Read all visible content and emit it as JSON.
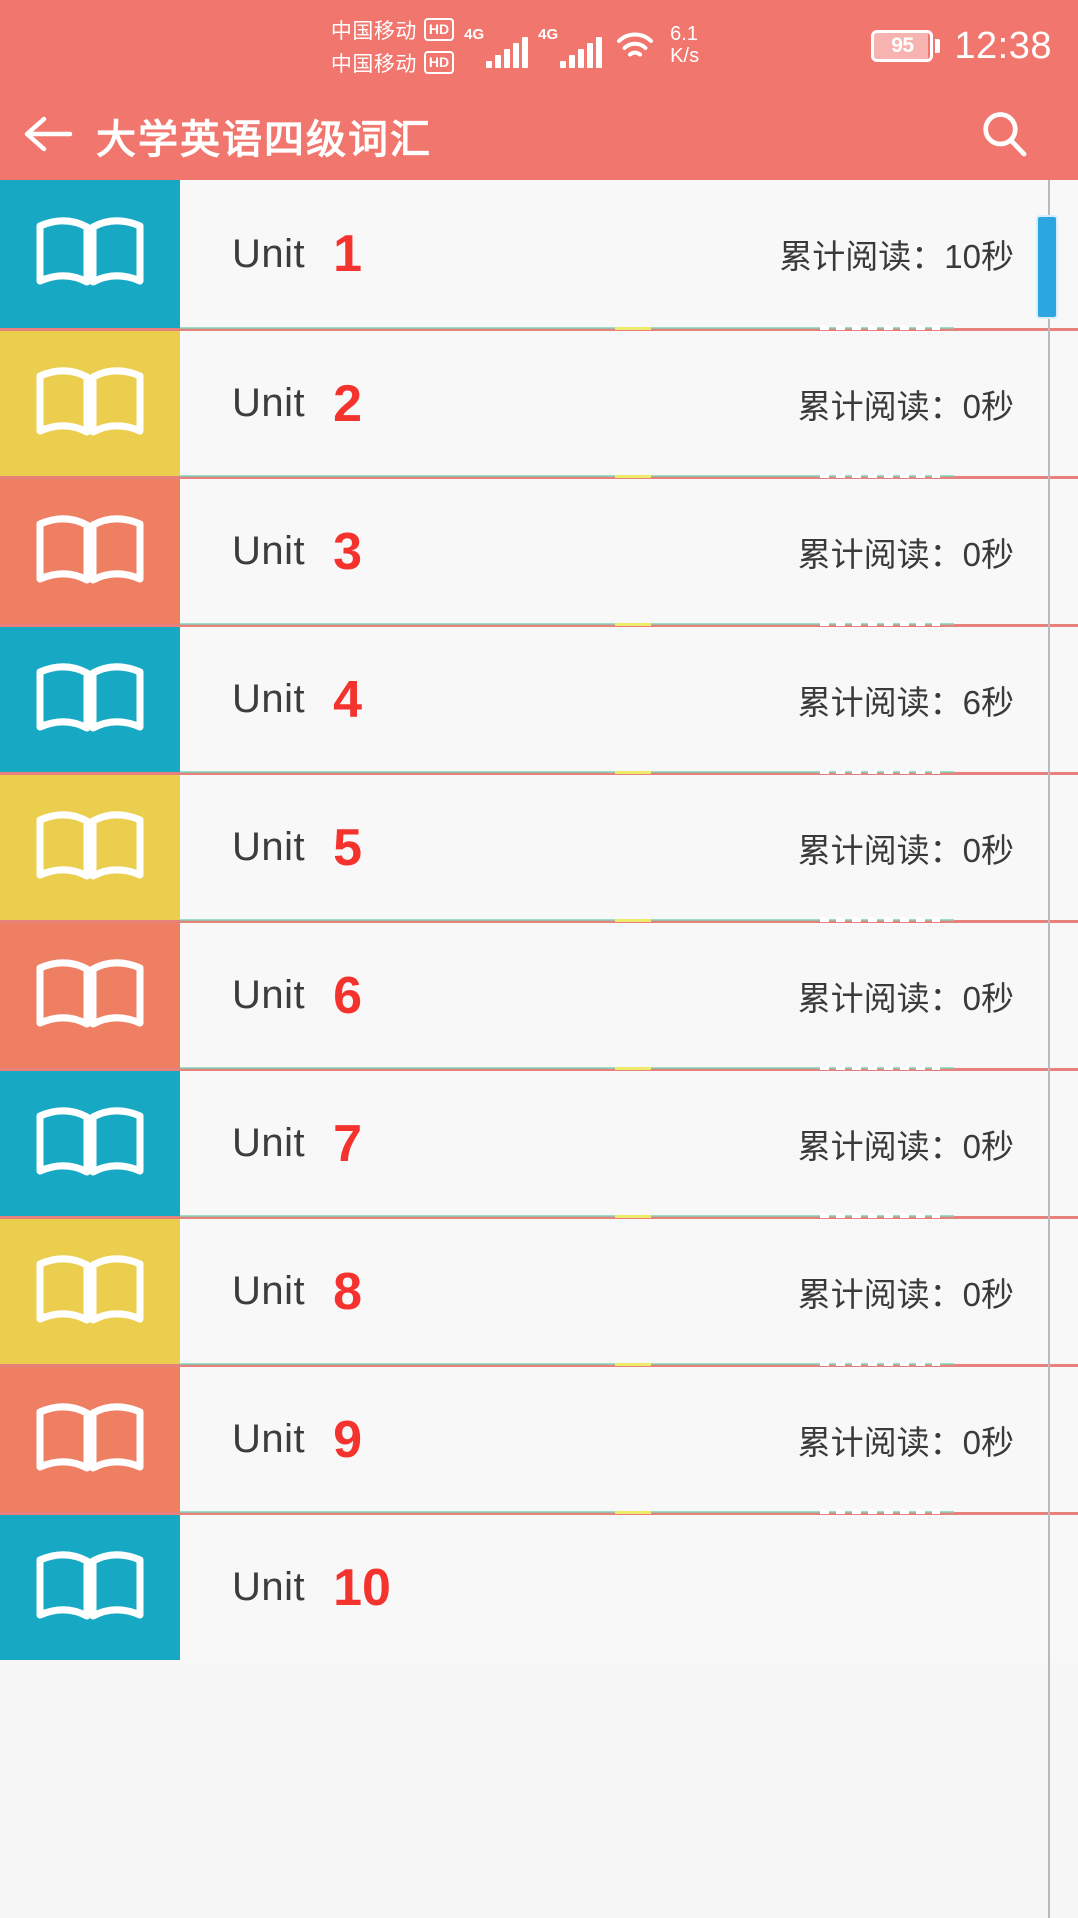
{
  "theme": {
    "brand": "#F0766E",
    "unit_number_color": "#F5332E",
    "tile_colors": [
      "#17A9C4",
      "#EBCE4E",
      "#EF7F63"
    ],
    "divider_color": "#E8817C",
    "scrollbar_color": "#2BA6E0",
    "row_background": "#F8F8F8"
  },
  "status_bar": {
    "carrier_lines": [
      {
        "name": "中国移动",
        "badge": "HD"
      },
      {
        "name": "中国移动",
        "badge": "HD"
      }
    ],
    "signal_1": {
      "generation": "4G",
      "bars": 5
    },
    "signal_2": {
      "generation": "4G",
      "bars": 5
    },
    "wifi": "wifi-icon",
    "net_speed_value": "6.1",
    "net_speed_unit": "K/s",
    "battery_percent": "95",
    "battery_level": 95,
    "time": "12:38"
  },
  "app_bar": {
    "back_icon": "arrow-left-icon",
    "title": "大学英语四级词汇",
    "search_icon": "search-icon"
  },
  "list": {
    "unit_prefix": "Unit",
    "rows": [
      {
        "unit": "1",
        "stat": "累计阅读：10秒",
        "tile": "#17A9C4",
        "icon": "open-book-icon"
      },
      {
        "unit": "2",
        "stat": "累计阅读：0秒",
        "tile": "#EBCE4E",
        "icon": "open-book-icon"
      },
      {
        "unit": "3",
        "stat": "累计阅读：0秒",
        "tile": "#EF7F63",
        "icon": "open-book-icon"
      },
      {
        "unit": "4",
        "stat": "累计阅读：6秒",
        "tile": "#17A9C4",
        "icon": "open-book-icon"
      },
      {
        "unit": "5",
        "stat": "累计阅读：0秒",
        "tile": "#EBCE4E",
        "icon": "open-book-icon"
      },
      {
        "unit": "6",
        "stat": "累计阅读：0秒",
        "tile": "#EF7F63",
        "icon": "open-book-icon"
      },
      {
        "unit": "7",
        "stat": "累计阅读：0秒",
        "tile": "#17A9C4",
        "icon": "open-book-icon"
      },
      {
        "unit": "8",
        "stat": "累计阅读：0秒",
        "tile": "#EBCE4E",
        "icon": "open-book-icon"
      },
      {
        "unit": "9",
        "stat": "累计阅读：0秒",
        "tile": "#EF7F63",
        "icon": "open-book-icon"
      },
      {
        "unit": "10",
        "stat": "",
        "tile": "#17A9C4",
        "icon": "open-book-icon"
      }
    ]
  },
  "scrollbar": {
    "thumb_position_percent": 2,
    "thumb_size_percent": 6
  }
}
